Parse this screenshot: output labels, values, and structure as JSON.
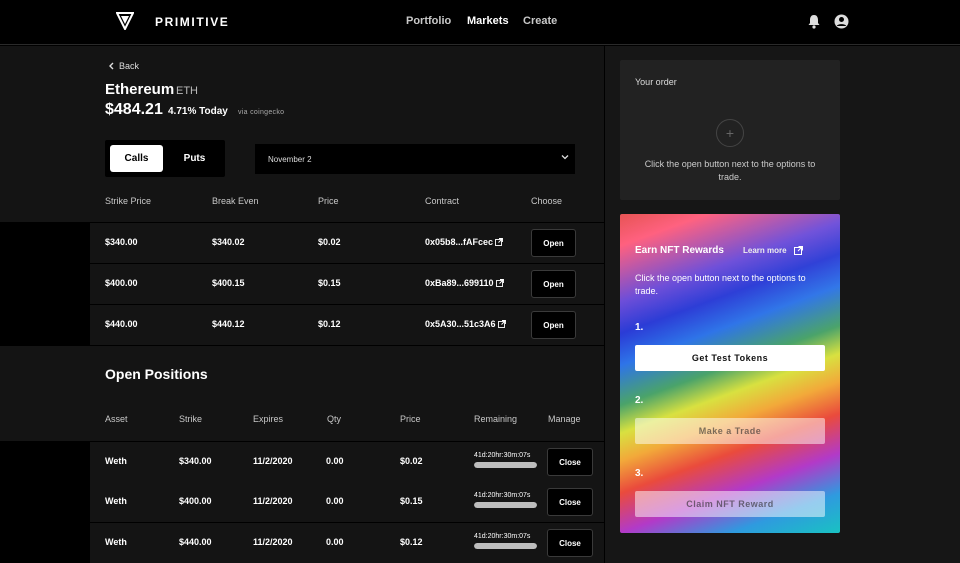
{
  "header": {
    "brand": "PRIMITIVE",
    "nav": [
      {
        "label": "Portfolio",
        "active": false
      },
      {
        "label": "Markets",
        "active": true
      },
      {
        "label": "Create",
        "active": false
      }
    ],
    "icons": [
      "logo-icon",
      "bell-icon",
      "user-icon"
    ]
  },
  "market": {
    "back_label": "Back",
    "asset_name": "Ethereum",
    "asset_symbol": "ETH",
    "price": "$484.21",
    "change": "4.71% Today",
    "source": "via coingecko",
    "toggle": {
      "calls": "Calls",
      "puts": "Puts",
      "selected": "Calls"
    },
    "expiry_selected": "November 2"
  },
  "options_table": {
    "headers": [
      "Strike Price",
      "Break Even",
      "Price",
      "Contract",
      "Choose"
    ],
    "rows": [
      {
        "strike": "$340.00",
        "break_even": "$340.02",
        "price": "$0.02",
        "contract": "0x05b8...fAFcec",
        "action": "Open"
      },
      {
        "strike": "$400.00",
        "break_even": "$400.15",
        "price": "$0.15",
        "contract": "0xBa89...699110",
        "action": "Open"
      },
      {
        "strike": "$440.00",
        "break_even": "$440.12",
        "price": "$0.12",
        "contract": "0x5A30...51c3A6",
        "action": "Open"
      }
    ]
  },
  "positions": {
    "title": "Open Positions",
    "headers": [
      "Asset",
      "Strike",
      "Expires",
      "Qty",
      "Price",
      "Remaining",
      "Manage"
    ],
    "rows": [
      {
        "asset": "Weth",
        "strike": "$340.00",
        "expires": "11/2/2020",
        "qty": "0.00",
        "price": "$0.02",
        "remaining": "41d:20hr:30m:07s",
        "remaining_fraction": 1.0,
        "action": "Close"
      },
      {
        "asset": "Weth",
        "strike": "$400.00",
        "expires": "11/2/2020",
        "qty": "0.00",
        "price": "$0.15",
        "remaining": "41d:20hr:30m:07s",
        "remaining_fraction": 1.0,
        "action": "Close"
      },
      {
        "asset": "Weth",
        "strike": "$440.00",
        "expires": "11/2/2020",
        "qty": "0.00",
        "price": "$0.12",
        "remaining": "41d:20hr:30m:07s",
        "remaining_fraction": 1.0,
        "action": "Close"
      }
    ]
  },
  "order": {
    "title": "Your order",
    "plus": "+",
    "message": "Click the open button next to the options to trade."
  },
  "nft": {
    "title": "Earn NFT Rewards",
    "learn_more": "Learn more",
    "message": "Click the open button next to the options to trade.",
    "steps": [
      {
        "number": "1.",
        "button": "Get Test Tokens",
        "enabled": true
      },
      {
        "number": "2.",
        "button": "Make a Trade",
        "enabled": false
      },
      {
        "number": "3.",
        "button": "Claim NFT Reward",
        "enabled": false
      }
    ]
  },
  "colors": {
    "background": "#000000",
    "panel": "#141414",
    "right_panel": "#161616",
    "card": "#222222",
    "accent": "#ffffff"
  }
}
